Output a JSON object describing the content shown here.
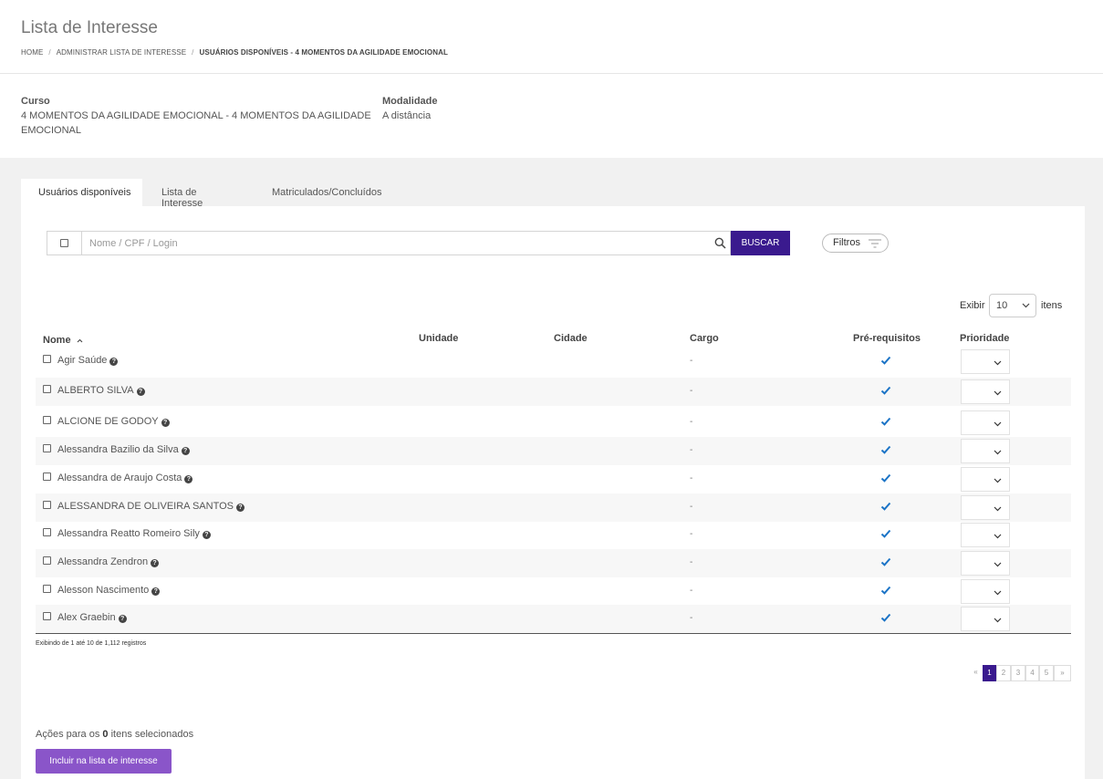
{
  "header": {
    "title": "Lista de Interesse",
    "breadcrumb": [
      "HOME",
      "ADMINISTRAR LISTA DE INTERESSE",
      "USUÁRIOS DISPONÍVEIS - 4 MOMENTOS DA AGILIDADE EMOCIONAL"
    ]
  },
  "info": {
    "curso_label": "Curso",
    "curso_value_line1": "4 MOMENTOS DA AGILIDADE EMOCIONAL - 4 MOMENTOS DA AGILIDADE",
    "curso_value_line2": "EMOCIONAL",
    "modalidade_label": "Modalidade",
    "modalidade_value": "A distância"
  },
  "tabs": [
    {
      "label": "Usuários disponíveis",
      "active": true
    },
    {
      "label": "Lista de Interesse",
      "active": false
    },
    {
      "label": "Matriculados/Concluídos",
      "active": false
    }
  ],
  "search": {
    "placeholder": "Nome / CPF / Login",
    "value": "",
    "button_label": "BUSCAR",
    "filter_label": "Filtros"
  },
  "page_size": {
    "label_before": "Exibir",
    "value": "10",
    "label_after": "itens"
  },
  "table": {
    "columns": {
      "nome": "Nome",
      "unidade": "Unidade",
      "cidade": "Cidade",
      "cargo": "Cargo",
      "prerequisitos": "Pré-requisitos",
      "prioridade": "Prioridade"
    },
    "sort_indicator": "^",
    "rows": [
      {
        "name": "Agir Saúde",
        "cargo": "-"
      },
      {
        "name": "ALBERTO SILVA",
        "cargo": "-"
      },
      {
        "name": "ALCIONE DE GODOY",
        "cargo": "-"
      },
      {
        "name": "Alessandra Bazilio da Silva",
        "cargo": "-"
      },
      {
        "name": "Alessandra de Araujo Costa",
        "cargo": "-"
      },
      {
        "name": "ALESSANDRA DE OLIVEIRA SANTOS",
        "cargo": "-"
      },
      {
        "name": "Alessandra Reatto Romeiro Sily",
        "cargo": "-"
      },
      {
        "name": "Alessandra Zendron",
        "cargo": "-"
      },
      {
        "name": "Alesson Nascimento",
        "cargo": "-"
      },
      {
        "name": "Alex Graebin",
        "cargo": "-"
      }
    ],
    "records_text": "Exibindo de 1 até 10 de 1,112 registros"
  },
  "pagination": {
    "first": "«",
    "pages": [
      "1",
      "2",
      "3",
      "4",
      "5"
    ],
    "current": "1",
    "last": "»"
  },
  "actions": {
    "prefix": "Ações para os",
    "count": "0",
    "suffix": "itens selecionados",
    "include_button": "Incluir na lista de interesse"
  },
  "colors": {
    "primary": "#3a1a8e",
    "secondary": "#8a55c9",
    "check": "#1a73c6"
  }
}
